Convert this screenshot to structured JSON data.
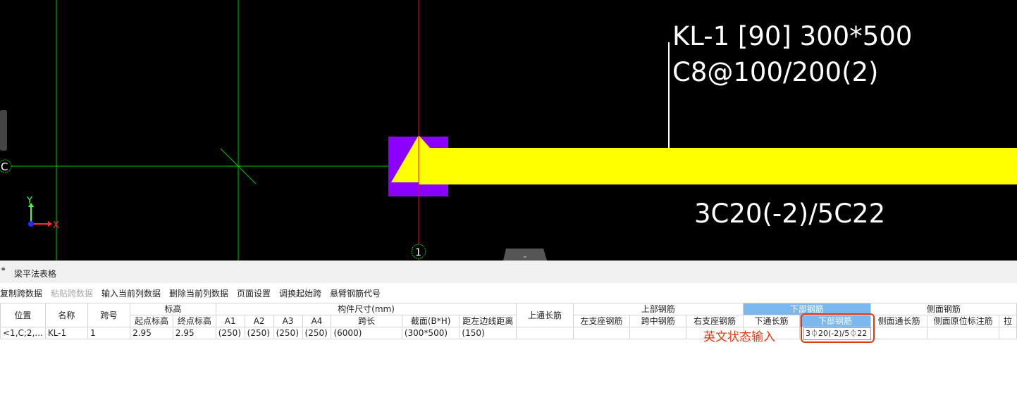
{
  "cad_view": {
    "beam_label_line1": "KL-1 [90] 300*500",
    "beam_label_line2": "C8@100/200(2)",
    "bottom_rebar_label": "3C20(-2)/5C22",
    "axis_c": "C",
    "axis_1": "1",
    "axis_x": "X",
    "axis_y": "Y",
    "colors": {
      "beam": "#ffff00",
      "column": "#8b00ff",
      "grid_line": "#00c800",
      "axis_line": "#ff0000",
      "background": "#000000"
    }
  },
  "panel": {
    "title": "梁平法表格",
    "toolbar": [
      {
        "label": "复制跨数据",
        "enabled": true
      },
      {
        "label": "粘贴跨数据",
        "enabled": false
      },
      {
        "label": "输入当前列数据",
        "enabled": true
      },
      {
        "label": "删除当前列数据",
        "enabled": true
      },
      {
        "label": "页面设置",
        "enabled": true
      },
      {
        "label": "调换起始跨",
        "enabled": true
      },
      {
        "label": "悬臂钢筋代号",
        "enabled": true
      }
    ]
  },
  "table": {
    "headers": {
      "position": "位置",
      "name": "名称",
      "span_no": "跨号",
      "elevation": "标高",
      "start_elev": "起点标高",
      "end_elev": "终点标高",
      "dims": "构件尺寸(mm)",
      "a1": "A1",
      "a2": "A2",
      "a3": "A3",
      "a4": "A4",
      "span_len": "跨长",
      "section": "截面(B*H)",
      "edge_dist": "距左边线距离",
      "top_through": "上通长筋",
      "top_rebar": "上部钢筋",
      "left_support": "左支座钢筋",
      "mid_span": "跨中钢筋",
      "right_support": "右支座钢筋",
      "bottom_rebar_group": "下部钢筋",
      "bottom_through": "下通长筋",
      "bottom_rebar": "下部钢筋",
      "side_rebar": "侧面钢筋",
      "side_through": "侧面通长筋",
      "side_in_situ": "侧面原位标注筋",
      "tie": "拉"
    },
    "row": {
      "position": "<1,C;2,...",
      "name": "KL-1",
      "span_no": "1",
      "start_elev": "2.95",
      "end_elev": "2.95",
      "a1": "(250)",
      "a2": "(250)",
      "a3": "(250)",
      "a4": "(250)",
      "span_len": "(6000)",
      "section": "(300*500)",
      "edge_dist": "(150)",
      "bottom_rebar_value": "3⏀20(-2)/5⏀22"
    }
  },
  "annotation": {
    "note": "英文状态输入"
  }
}
